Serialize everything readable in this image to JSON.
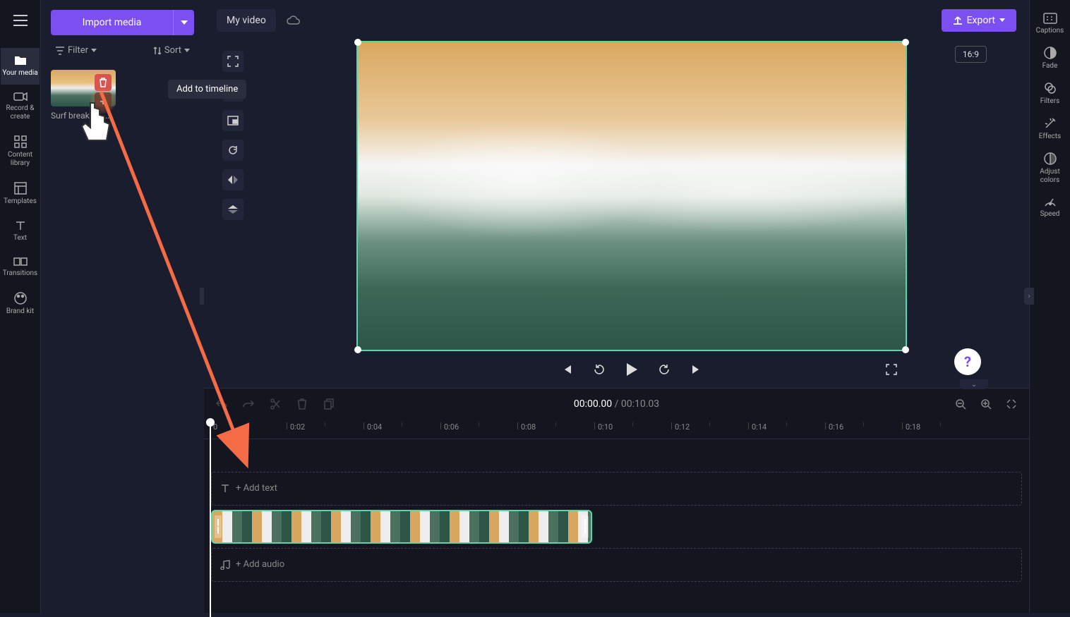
{
  "header": {
    "video_name": "My video",
    "export_label": "Export",
    "aspect_ratio": "16:9"
  },
  "import_button": "Import media",
  "filter_label": "Filter",
  "sort_label": "Sort",
  "media": {
    "clip_title": "Surf breaking ...",
    "tooltip": "Add to timeline"
  },
  "left_nav": [
    {
      "label": "Your media",
      "icon": "folder"
    },
    {
      "label": "Record & create",
      "icon": "camera"
    },
    {
      "label": "Content library",
      "icon": "grid"
    },
    {
      "label": "Templates",
      "icon": "layout"
    },
    {
      "label": "Text",
      "icon": "text"
    },
    {
      "label": "Transitions",
      "icon": "transitions"
    },
    {
      "label": "Brand kit",
      "icon": "palette"
    }
  ],
  "right_nav": [
    {
      "label": "Captions",
      "icon": "captions"
    },
    {
      "label": "Fade",
      "icon": "fade"
    },
    {
      "label": "Filters",
      "icon": "filters"
    },
    {
      "label": "Effects",
      "icon": "effects"
    },
    {
      "label": "Adjust colors",
      "icon": "adjust"
    },
    {
      "label": "Speed",
      "icon": "speed"
    }
  ],
  "timeline": {
    "current_time": "00:00.00",
    "total_time": "00:10.03",
    "add_text_label": "+ Add text",
    "add_audio_label": "+ Add audio",
    "ruler_marks": [
      "0",
      "0:02",
      "0:04",
      "0:06",
      "0:08",
      "0:10",
      "0:12",
      "0:14",
      "0:16",
      "0:18"
    ]
  }
}
